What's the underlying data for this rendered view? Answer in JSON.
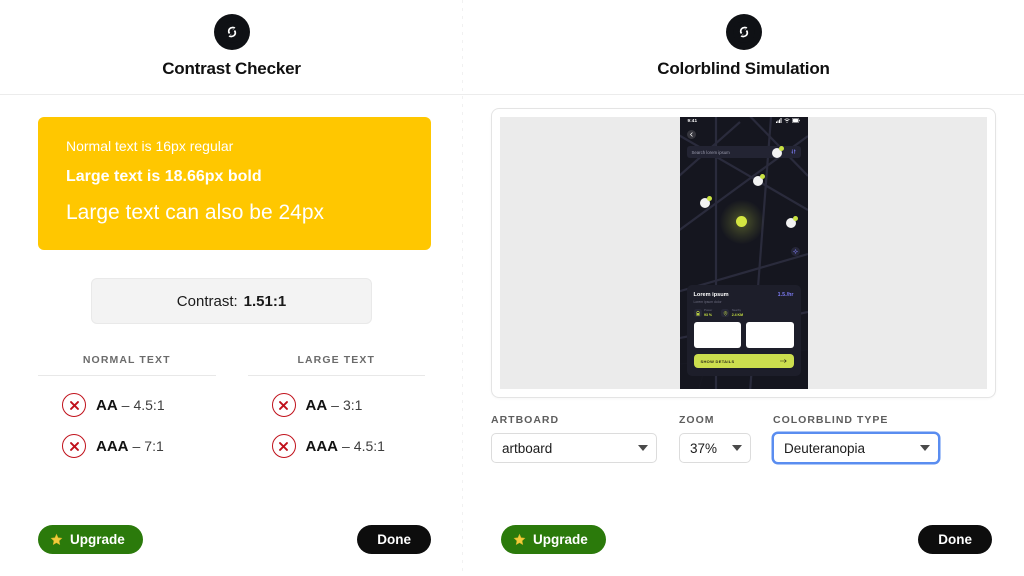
{
  "left": {
    "logo_icon": "shuffle-circle-logo",
    "title": "Contrast Checker",
    "swatch": {
      "bg_color": "#FFC700",
      "text_color": "#FFFFFF",
      "lines": [
        "Normal text is 16px regular",
        "Large text is 18.66px bold",
        "Large text can also be 24px"
      ]
    },
    "contrast": {
      "label": "Contrast:",
      "value": "1.51:1"
    },
    "columns": [
      {
        "header": "NORMAL TEXT",
        "criteria": [
          {
            "icon": "circle-x-icon",
            "status_color": "#C0111B",
            "level": "AA",
            "dash": "–",
            "ratio": "4.5:1"
          },
          {
            "icon": "circle-x-icon",
            "status_color": "#C0111B",
            "level": "AAA",
            "dash": "–",
            "ratio": "7:1"
          }
        ]
      },
      {
        "header": "LARGE TEXT",
        "criteria": [
          {
            "icon": "circle-x-icon",
            "status_color": "#C0111B",
            "level": "AA",
            "dash": "–",
            "ratio": "3:1"
          },
          {
            "icon": "circle-x-icon",
            "status_color": "#C0111B",
            "level": "AAA",
            "dash": "–",
            "ratio": "4.5:1"
          }
        ]
      }
    ],
    "footer": {
      "upgrade_label": "Upgrade",
      "upgrade_icon": "star-icon",
      "upgrade_color": "#2B7A0B",
      "done_label": "Done",
      "done_color": "#0D0D0D"
    }
  },
  "right": {
    "logo_icon": "shuffle-circle-logo",
    "title": "Colorblind Simulation",
    "preview": {
      "phone": {
        "status_time": "9:41",
        "status_icons": [
          "cellular-icon",
          "wifi-icon",
          "battery-icon"
        ],
        "back_icon": "back-arrow-icon",
        "search_placeholder": "Search lorem ipsum",
        "search_filter_icon": "filter-icon",
        "locate_icon": "locate-icon",
        "card": {
          "title": "Lorem ipsum",
          "price": "1.5./hr",
          "subtitle": "Lorem ipsum dolor",
          "stats": [
            {
              "icon": "battery-icon",
              "key": "Power",
              "value": "93 %"
            },
            {
              "icon": "location-pin-icon",
              "key": "Nearby",
              "value": "2.4 KM"
            }
          ],
          "cta_label": "SHOW DETAILS",
          "cta_icon": "arrow-right-icon",
          "cta_color": "#CCDE4E"
        }
      }
    },
    "controls": [
      {
        "name": "artboard",
        "label": "ARTBOARD",
        "value": "artboard",
        "focused": false
      },
      {
        "name": "zoom",
        "label": "ZOOM",
        "value": "37%",
        "focused": false
      },
      {
        "name": "colorblind-type",
        "label": "COLORBLIND TYPE",
        "value": "Deuteranopia",
        "focused": true
      }
    ],
    "footer": {
      "upgrade_label": "Upgrade",
      "upgrade_icon": "star-icon",
      "upgrade_color": "#2B7A0B",
      "done_label": "Done",
      "done_color": "#0D0D0D"
    }
  }
}
